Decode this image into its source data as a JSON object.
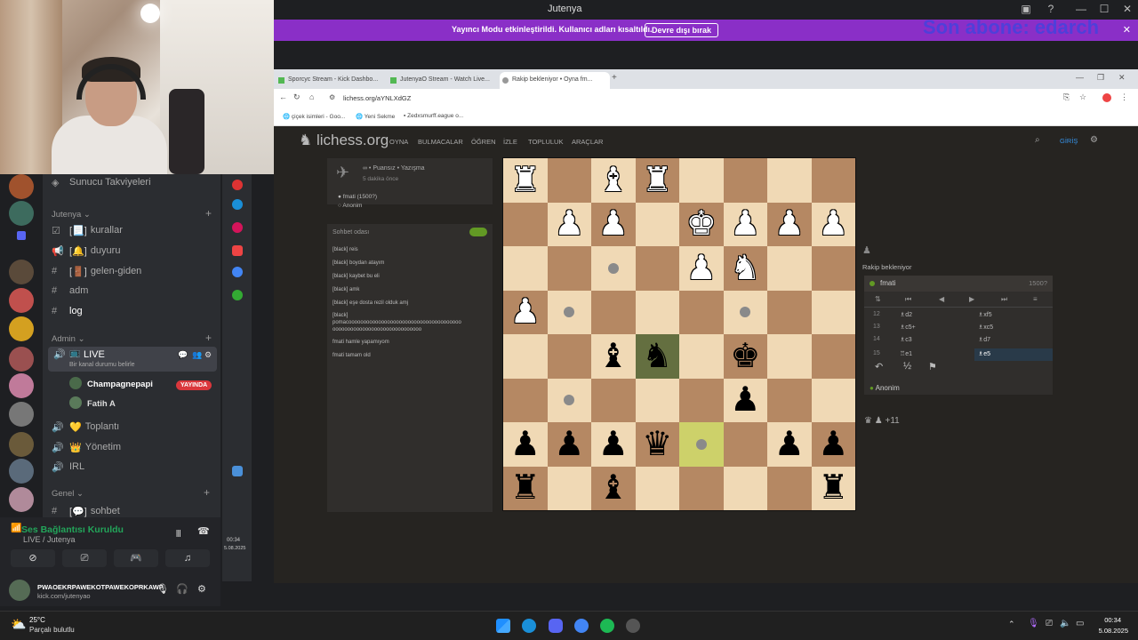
{
  "window": {
    "title": "Jutenya"
  },
  "overlay": {
    "text": "Son abone: edarch"
  },
  "banner": {
    "message": "Yayıncı Modu etkinleştirildi. Kullanıcı adları kısaltıldı.",
    "button": "Devre dışı bırak"
  },
  "channels": {
    "top_item": "Sunucu Takviyeleri",
    "cat_jutenya": "Jutenya",
    "items_jutenya": [
      {
        "label": "kurallar"
      },
      {
        "label": "duyuru"
      },
      {
        "label": "gelen-giden"
      },
      {
        "label": "adm"
      },
      {
        "label": "log"
      }
    ],
    "cat_admin": "Admin",
    "live_channel": "LIVE",
    "live_status": "Bir kanal durumu belirle",
    "users": [
      "Champagnepapi",
      "Fatih A"
    ],
    "live_badge": "YAYINDA",
    "voice_items": [
      "Toplantı",
      "Yönetim",
      "IRL"
    ],
    "cat_genel": "Genel",
    "genel_item": "sohbet"
  },
  "voice": {
    "status": "Ses Bağlantısı Kuruldu",
    "channel": "LIVE / Jutenya"
  },
  "user": {
    "name": "PWAOEKRPAWEKOTPAWEKOPRKAWP",
    "status": "kick.com/jutenyao"
  },
  "strip": {
    "time": "00:34",
    "date": "5.08.2025"
  },
  "browser": {
    "tabs": [
      "Sporcyc Stream - Kick Dashbo...",
      "JutenyaO Stream - Watch Live...",
      "Rakip bekleniyor • Oyna fm..."
    ],
    "url": "lichess.org/aYNLXdGZ",
    "bookmarks": [
      "çiçek isimleri - Goo...",
      "Yeni Sekme",
      "Zedxsmurff.eague o..."
    ]
  },
  "lichess": {
    "logo": "lichess.org",
    "nav": [
      "OYNA",
      "BULMACALAR",
      "ÖĞREN",
      "İZLE",
      "TOPLULUK",
      "ARAÇLAR"
    ],
    "login": "GİRİŞ",
    "game_line1": "∞ • Puansız • Yazışma",
    "game_line2": "5 dakika önce",
    "white_player": "fmati (1500?)",
    "black_player": "Anonim",
    "chat_title": "Sohbet odası",
    "chat": [
      "[black] reis",
      "[black] boydan atayım",
      "[black] kaybet bu eli",
      "[black] amk",
      "[black] eşe dosta rezil olduk amj",
      "[black]",
      "pomacoooooooooooooooooooooooooooooooooooooo",
      "oooooooooooooooooooooooooooooo",
      "fmati  hamle yapamıyom",
      "fmati  tamam old"
    ],
    "waiting": "Rakip bekleniyor",
    "opponent": "fmati",
    "opponent_rating": "1500?",
    "moves": [
      {
        "n": "12",
        "w": "♗d2",
        "b": "♗xf5"
      },
      {
        "n": "13",
        "w": "♗c5+",
        "b": "♗xc5"
      },
      {
        "n": "14",
        "w": "♗c3",
        "b": "♗d7"
      },
      {
        "n": "15",
        "w": "♖e1",
        "b": "♗e5"
      }
    ],
    "anon": "Anonim",
    "captured": "♛ ♟ +11",
    "board": [
      [
        "wR",
        "",
        "wB",
        "wR",
        "",
        "",
        "",
        ""
      ],
      [
        "",
        "wP",
        "wP",
        "",
        "wK",
        "wP",
        "wP",
        "wP"
      ],
      [
        "",
        "",
        ".",
        "",
        "wP",
        "wN",
        "",
        ""
      ],
      [
        "wP",
        ".",
        "",
        "",
        "",
        ".",
        "",
        ""
      ],
      [
        "",
        "",
        "bB",
        "bN",
        "",
        "bK",
        "",
        ""
      ],
      [
        "",
        ".",
        "",
        "",
        "",
        "bP",
        "",
        ""
      ],
      [
        "bP",
        "bP",
        "bP",
        "bQ",
        ".",
        "",
        "bP",
        "bP"
      ],
      [
        "bR",
        "",
        "bB",
        "",
        "",
        "",
        "",
        "bR"
      ]
    ]
  },
  "taskbar": {
    "temp": "25°C",
    "weather": "Parçalı bulutlu",
    "time": "00:34",
    "date": "5.08.2025"
  }
}
